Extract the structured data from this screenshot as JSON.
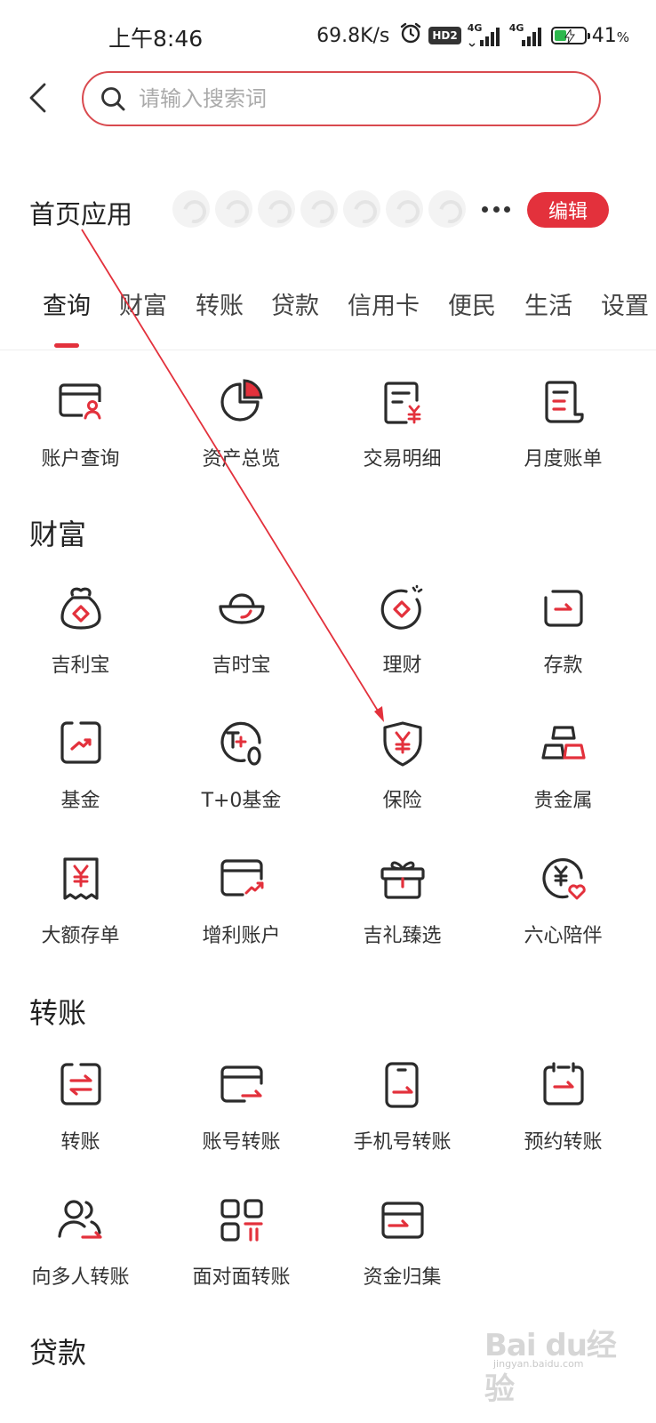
{
  "status_bar": {
    "time": "上午8:46",
    "net_speed": "69.8K/s",
    "hd_badge": "HD2",
    "sig1_label": "4G",
    "sig2_label": "4G",
    "battery_percent": "41",
    "battery_unit": "%",
    "battery_level": 0.41
  },
  "search": {
    "placeholder": "请输入搜索词"
  },
  "home_apps": {
    "title": "首页应用",
    "edit_label": "编辑"
  },
  "tabs": [
    {
      "label": "查询"
    },
    {
      "label": "财富"
    },
    {
      "label": "转账"
    },
    {
      "label": "贷款"
    },
    {
      "label": "信用卡"
    },
    {
      "label": "便民"
    },
    {
      "label": "生活"
    },
    {
      "label": "设置"
    }
  ],
  "query": {
    "items": [
      {
        "label": "账户查询",
        "icon": "account-query-icon"
      },
      {
        "label": "资产总览",
        "icon": "asset-overview-icon"
      },
      {
        "label": "交易明细",
        "icon": "transaction-detail-icon"
      },
      {
        "label": "月度账单",
        "icon": "monthly-bill-icon"
      }
    ]
  },
  "wealth": {
    "title": "财富",
    "items": [
      {
        "label": "吉利宝",
        "icon": "money-bag-icon"
      },
      {
        "label": "吉时宝",
        "icon": "gold-ingot-icon"
      },
      {
        "label": "理财",
        "icon": "wealth-management-icon"
      },
      {
        "label": "存款",
        "icon": "deposit-icon"
      },
      {
        "label": "基金",
        "icon": "fund-icon"
      },
      {
        "label": "T+0基金",
        "icon": "t0-fund-icon"
      },
      {
        "label": "保险",
        "icon": "insurance-shield-icon"
      },
      {
        "label": "贵金属",
        "icon": "precious-metal-icon"
      },
      {
        "label": "大额存单",
        "icon": "large-deposit-icon"
      },
      {
        "label": "增利账户",
        "icon": "profit-account-icon"
      },
      {
        "label": "吉礼臻选",
        "icon": "gift-box-icon"
      },
      {
        "label": "六心陪伴",
        "icon": "heart-yuan-icon"
      }
    ]
  },
  "transfer": {
    "title": "转账",
    "items": [
      {
        "label": "转账",
        "icon": "transfer-icon"
      },
      {
        "label": "账号转账",
        "icon": "account-transfer-icon"
      },
      {
        "label": "手机号转账",
        "icon": "phone-transfer-icon"
      },
      {
        "label": "预约转账",
        "icon": "scheduled-transfer-icon"
      },
      {
        "label": "向多人转账",
        "icon": "multi-transfer-icon"
      },
      {
        "label": "面对面转账",
        "icon": "qr-transfer-icon"
      },
      {
        "label": "资金归集",
        "icon": "fund-collection-icon"
      }
    ]
  },
  "loan": {
    "title": "贷款"
  },
  "watermark": {
    "main": "Bai du经验",
    "sub": "jingyan.baidu.com"
  },
  "colors": {
    "accent": "#e3313c",
    "icon_stroke": "#2b2b2b",
    "search_border": "#d94a4f"
  }
}
